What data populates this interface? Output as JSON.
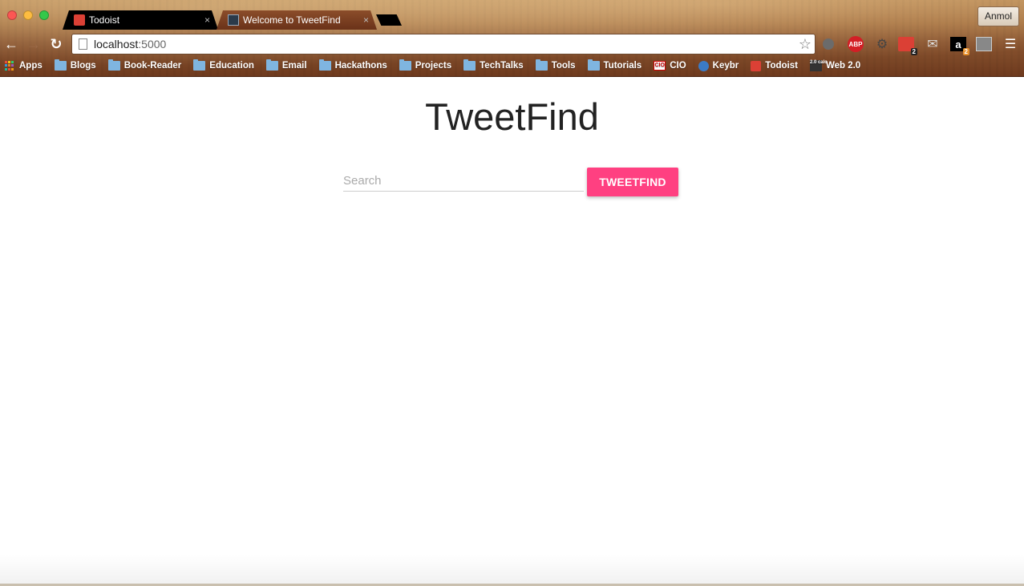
{
  "browser": {
    "tabs": [
      {
        "title": "Todoist",
        "icon": "todoist-icon",
        "active": false
      },
      {
        "title": "Welcome to TweetFind",
        "icon": "terminal-icon",
        "active": true
      }
    ],
    "tab_close_glyph": "×",
    "profile_name": "Anmol",
    "address": {
      "host": "localhost",
      "port": ":5000"
    },
    "nav": {
      "back_glyph": "←",
      "forward_glyph": "→",
      "reload_glyph": "↻",
      "star_glyph": "☆"
    },
    "extensions": {
      "abp_label": "ABP",
      "todoist_badge": "2",
      "amazon_label": "a",
      "amazon_badge": "2",
      "menu_glyph": "☰"
    },
    "bookmarks": [
      {
        "label": "Apps",
        "icon": "apps-grid-icon"
      },
      {
        "label": "Blogs",
        "icon": "folder-icon"
      },
      {
        "label": "Book-Reader",
        "icon": "folder-icon"
      },
      {
        "label": "Education",
        "icon": "folder-icon"
      },
      {
        "label": "Email",
        "icon": "folder-icon"
      },
      {
        "label": "Hackathons",
        "icon": "folder-icon"
      },
      {
        "label": "Projects",
        "icon": "folder-icon"
      },
      {
        "label": "TechTalks",
        "icon": "folder-icon"
      },
      {
        "label": "Tools",
        "icon": "folder-icon"
      },
      {
        "label": "Tutorials",
        "icon": "folder-icon"
      },
      {
        "label": "CIO",
        "icon": "cio-icon"
      },
      {
        "label": "Keybr",
        "icon": "keybr-icon"
      },
      {
        "label": "Todoist",
        "icon": "todoist-icon"
      },
      {
        "label": "Web 2.0",
        "icon": "web20-calc-icon"
      }
    ],
    "cio_icon_text": "CIO",
    "web20_icon_text": "2.0 calc"
  },
  "page": {
    "title": "TweetFind",
    "search_placeholder": "Search",
    "search_value": "",
    "button_label": "TWEETFIND"
  },
  "colors": {
    "accent": "#ff4081",
    "title_text": "#222222"
  }
}
